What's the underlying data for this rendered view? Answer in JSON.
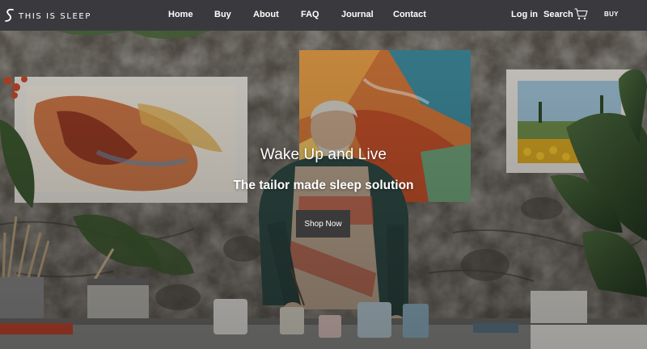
{
  "brand": {
    "name": "THIS IS SLEEP",
    "logo_icon": "s-logo-icon"
  },
  "nav": {
    "items": [
      {
        "label": "Home"
      },
      {
        "label": "Buy"
      },
      {
        "label": "About"
      },
      {
        "label": "FAQ"
      },
      {
        "label": "Journal"
      },
      {
        "label": "Contact"
      }
    ],
    "login_label": "Log in",
    "search_label": "Search",
    "cart_icon": "cart-icon",
    "buy_label": "BUY"
  },
  "hero": {
    "title": "Wake Up and Live",
    "subtitle": "The tailor made sleep solution",
    "cta_label": "Shop Now",
    "image": "photo of an older man in a studio with paintings on stone wall"
  },
  "colors": {
    "topbar_bg": "#3a3a3e",
    "nav_text": "#ffffff",
    "button_bg": "#3a3a3a"
  }
}
